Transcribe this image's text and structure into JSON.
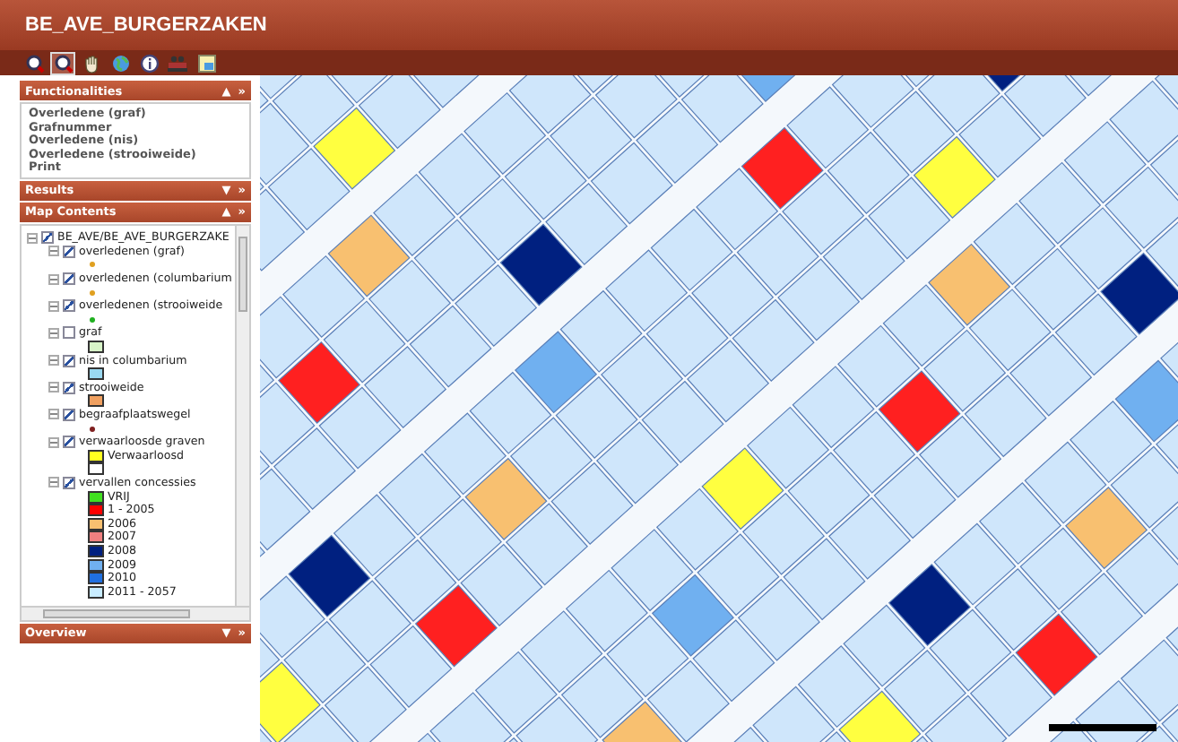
{
  "app": {
    "title": "BE_AVE_BURGERZAKEN"
  },
  "toolbar": [
    {
      "kind": "zoom-in",
      "selected": false
    },
    {
      "kind": "zoom-out",
      "selected": true
    },
    {
      "kind": "pan",
      "selected": false
    },
    {
      "kind": "globe",
      "selected": false
    },
    {
      "kind": "info",
      "selected": false
    },
    {
      "kind": "people",
      "selected": false
    },
    {
      "kind": "layers",
      "selected": false
    }
  ],
  "functionalities": {
    "title": "Functionalities",
    "toggle": "▲",
    "more": "»",
    "items": [
      "Overledene (graf)",
      "Grafnummer",
      "Overledene (nis)",
      "Overledene (strooiweide)",
      "Print"
    ]
  },
  "results": {
    "title": "Results",
    "toggle": "▼",
    "more": "»"
  },
  "map_contents": {
    "title": "Map Contents",
    "toggle": "▲",
    "more": "»",
    "root": {
      "label": "BE_AVE/BE_AVE_BURGERZAKE",
      "checked": true,
      "children": [
        {
          "label": "overledenen (graf)",
          "checked": true,
          "legend": [
            {
              "kind": "dot",
              "color": "#e0a020"
            }
          ]
        },
        {
          "label": "overledenen (columbarium",
          "checked": true,
          "legend": [
            {
              "kind": "dot",
              "color": "#e0a020"
            }
          ]
        },
        {
          "label": "overledenen (strooiweide",
          "checked": true,
          "legend": [
            {
              "kind": "dot",
              "color": "#20b020"
            }
          ]
        },
        {
          "label": "graf",
          "checked": false,
          "legend": [
            {
              "kind": "box",
              "color": "#d8f5c8"
            }
          ]
        },
        {
          "label": "nis in columbarium",
          "checked": true,
          "legend": [
            {
              "kind": "box",
              "color": "#9ad8f0"
            }
          ]
        },
        {
          "label": "strooiweide",
          "checked": true,
          "legend": [
            {
              "kind": "box",
              "color": "#f0a060"
            }
          ]
        },
        {
          "label": "begraafplaatswegel",
          "checked": true,
          "legend": [
            {
              "kind": "dot",
              "color": "#802020"
            }
          ]
        },
        {
          "label": "verwaarloosde graven",
          "checked": true,
          "legend": [
            {
              "kind": "box",
              "color": "#ffff20",
              "label": "Verwaarloosd"
            },
            {
              "kind": "box",
              "color": "#ffffff"
            }
          ]
        },
        {
          "label": "vervallen concessies",
          "checked": true,
          "legend": [
            {
              "kind": "box",
              "color": "#40e020",
              "label": "VRIJ"
            },
            {
              "kind": "box",
              "color": "#ff0000",
              "label": "1 - 2005"
            },
            {
              "kind": "box",
              "color": "#f8c070",
              "label": "2006"
            },
            {
              "kind": "box",
              "color": "#f08080",
              "label": "2007"
            },
            {
              "kind": "box",
              "color": "#002080",
              "label": "2008"
            },
            {
              "kind": "box",
              "color": "#70b0f0",
              "label": "2009"
            },
            {
              "kind": "box",
              "color": "#2070e0",
              "label": "2010"
            },
            {
              "kind": "box",
              "color": "#c8ecff",
              "label": "2011 - 2057"
            }
          ]
        }
      ]
    }
  },
  "overview": {
    "title": "Overview",
    "toggle": "▼",
    "more": "»"
  }
}
